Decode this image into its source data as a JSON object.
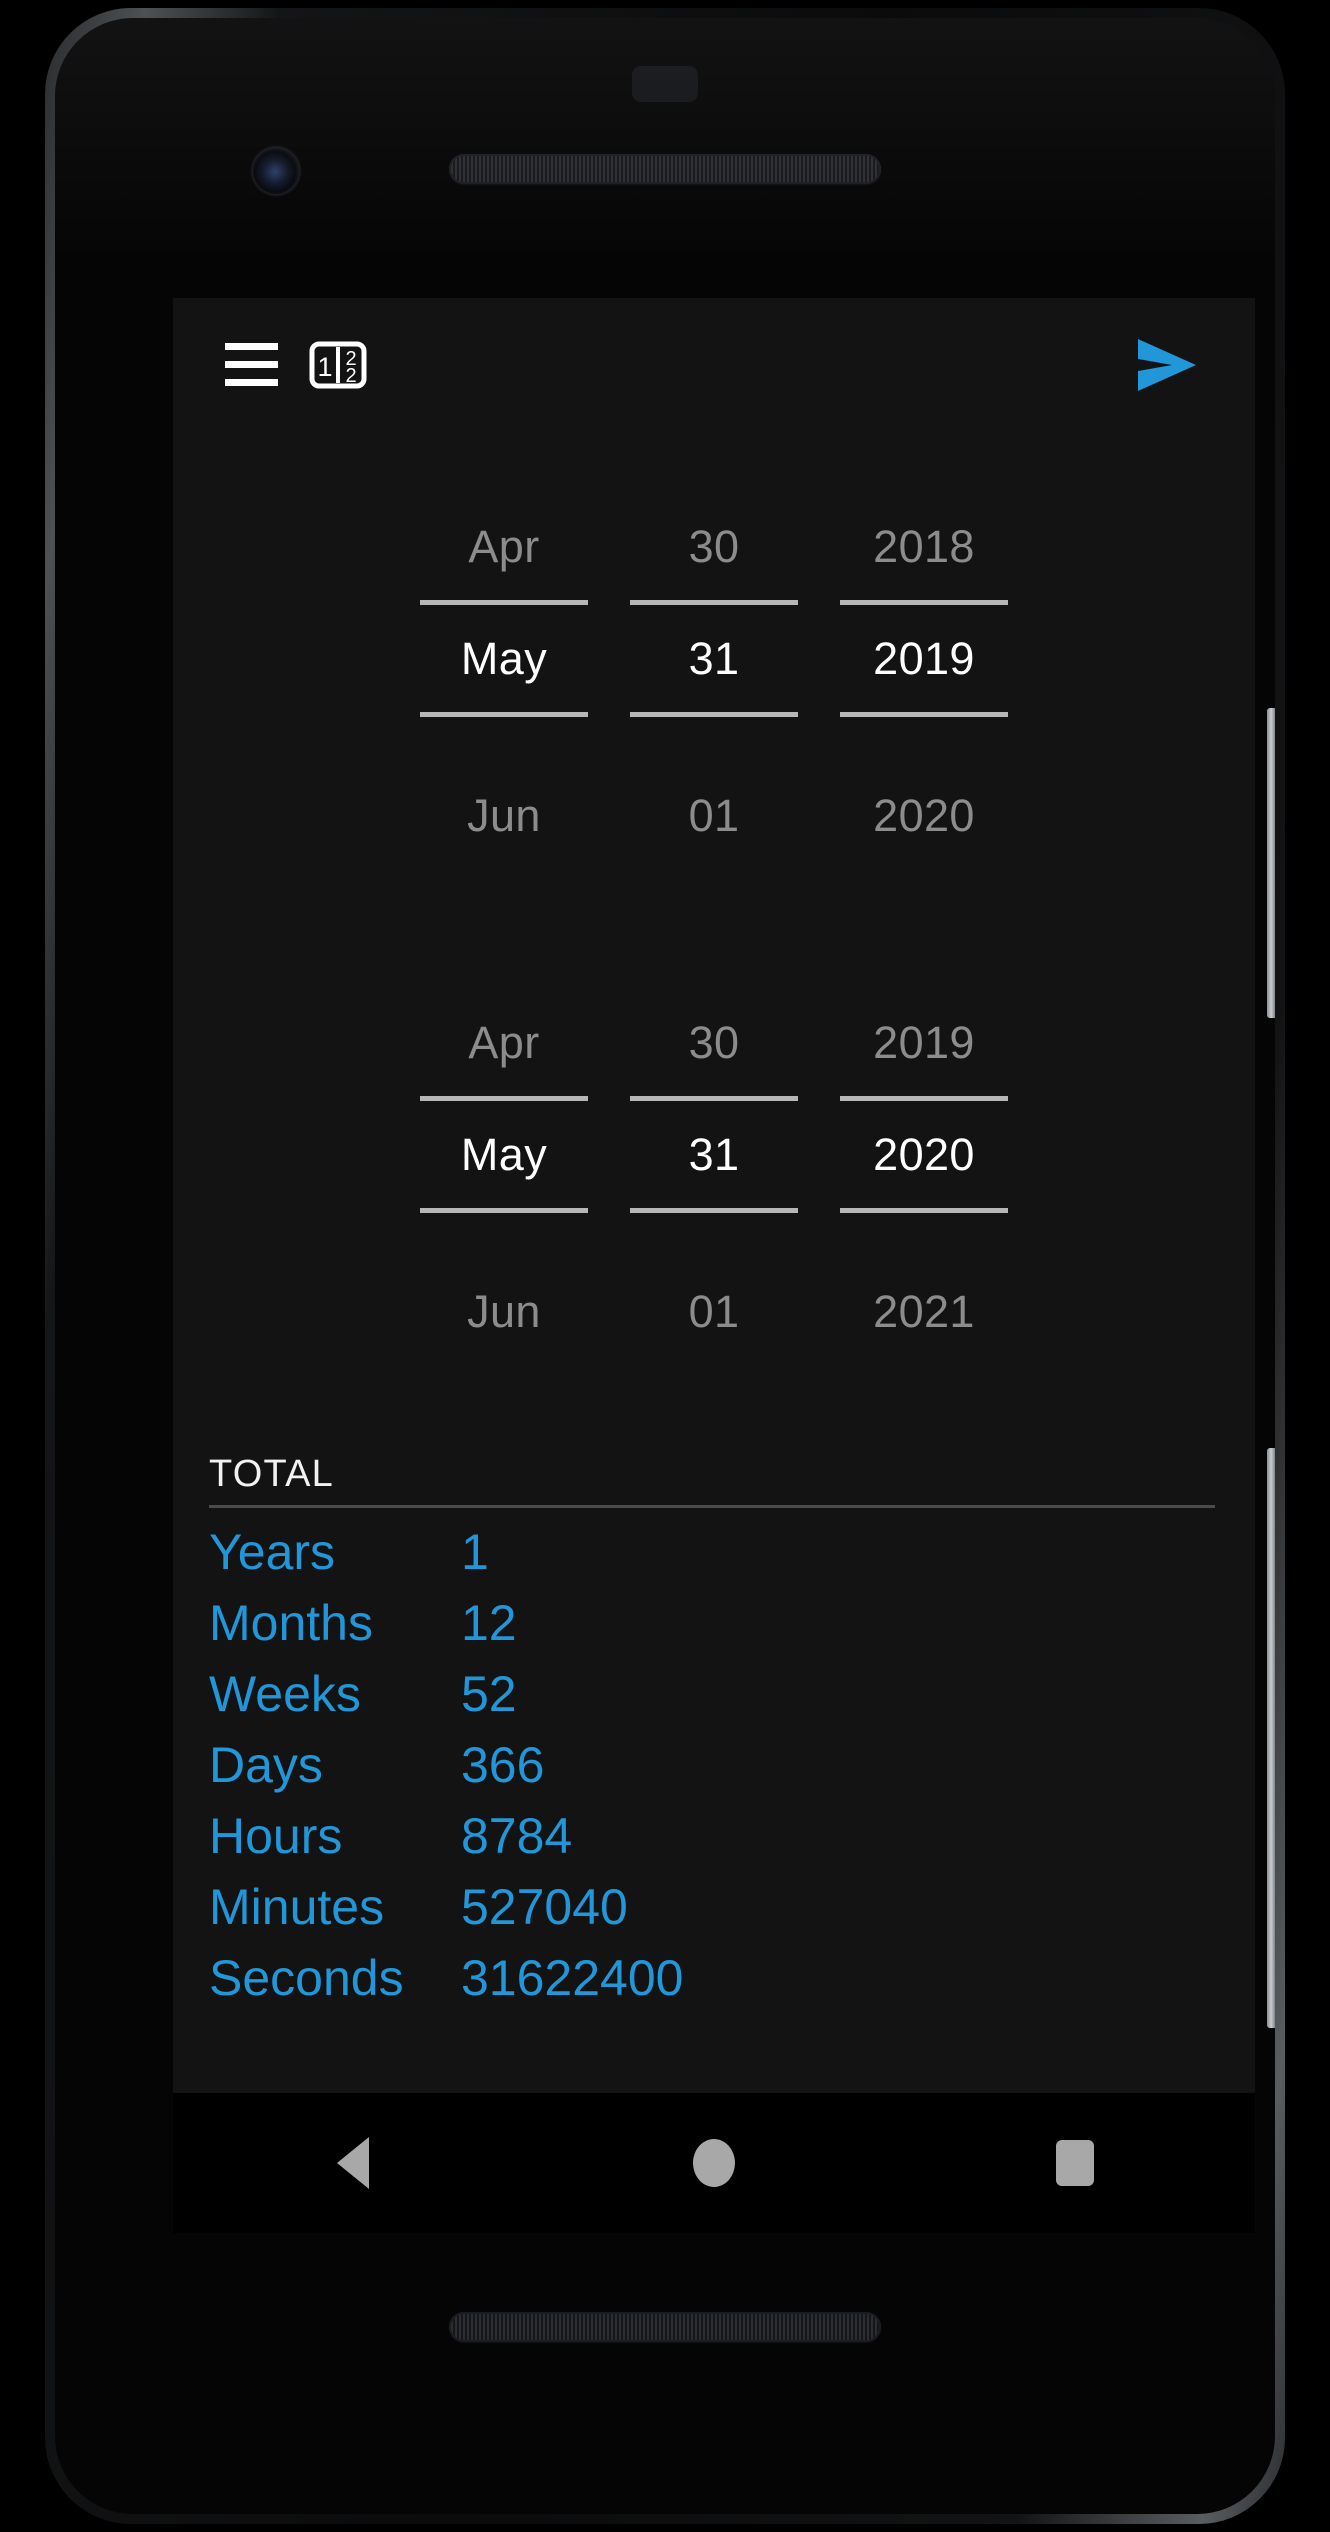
{
  "app": {
    "bar": {
      "menu_icon": "hamburger-menu-icon",
      "mode_icon": "twelve-hour-format-icon",
      "mode_icon_top": "1",
      "mode_icon_bottom": "2",
      "send_icon": "send-arrow-icon"
    },
    "accent_color": "#2196d8",
    "selected_text_color": "#ffffff",
    "dim_text_color": "#8c8c8c",
    "background_color": "#131313"
  },
  "pickers": [
    {
      "name": "start-date-picker",
      "columns": [
        {
          "name": "month",
          "previous": "Apr",
          "selected": "May",
          "next": "Jun"
        },
        {
          "name": "day",
          "previous": "30",
          "selected": "31",
          "next": "01"
        },
        {
          "name": "year",
          "previous": "2018",
          "selected": "2019",
          "next": "2020"
        }
      ]
    },
    {
      "name": "end-date-picker",
      "columns": [
        {
          "name": "month",
          "previous": "Apr",
          "selected": "May",
          "next": "Jun"
        },
        {
          "name": "day",
          "previous": "30",
          "selected": "31",
          "next": "01"
        },
        {
          "name": "year",
          "previous": "2019",
          "selected": "2020",
          "next": "2021"
        }
      ]
    }
  ],
  "totals": {
    "title": "TOTAL",
    "rows": [
      {
        "label": "Years",
        "value": "1"
      },
      {
        "label": "Months",
        "value": "12"
      },
      {
        "label": "Weeks",
        "value": "52"
      },
      {
        "label": "Days",
        "value": "366"
      },
      {
        "label": "Hours",
        "value": "8784"
      },
      {
        "label": "Minutes",
        "value": "527040"
      },
      {
        "label": "Seconds",
        "value": "31622400"
      }
    ]
  },
  "navbar": {
    "back_label": "Back",
    "home_label": "Home",
    "recents_label": "Recents"
  }
}
